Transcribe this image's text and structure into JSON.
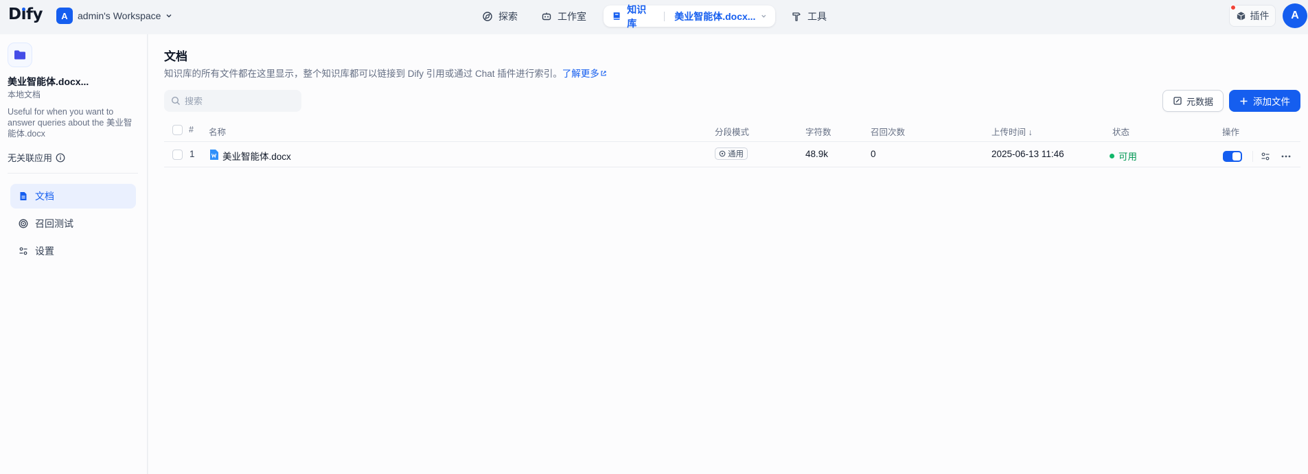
{
  "header": {
    "logo_text": "Dify",
    "workspace_avatar": "A",
    "workspace_name": "admin's Workspace",
    "nav": [
      {
        "label": "探索",
        "icon": "compass-icon"
      },
      {
        "label": "工作室",
        "icon": "robot-icon"
      },
      {
        "label": "知识库",
        "icon": "book-icon",
        "active": true,
        "dataset": "美业智能体.docx..."
      },
      {
        "label": "工具",
        "icon": "hammer-icon"
      }
    ],
    "plugins_label": "插件",
    "user_avatar": "A"
  },
  "sidebar": {
    "dataset_title": "美业智能体.docx...",
    "dataset_subtitle": "本地文档",
    "dataset_description": "Useful for when you want to answer queries about the 美业智能体.docx",
    "linked_apps": "无关联应用",
    "menu": [
      {
        "label": "文档",
        "icon": "document-icon",
        "active": true
      },
      {
        "label": "召回测试",
        "icon": "target-icon"
      },
      {
        "label": "设置",
        "icon": "settings-icon"
      }
    ]
  },
  "main": {
    "title": "文档",
    "description": "知识库的所有文件都在这里显示，整个知识库都可以链接到 Dify 引用或通过 Chat 插件进行索引。",
    "learn_more": "了解更多",
    "search_placeholder": "搜索",
    "metadata_button": "元数据",
    "add_file_button": "添加文件",
    "table": {
      "headers": [
        "#",
        "名称",
        "分段模式",
        "字符数",
        "召回次数",
        "上传时间 ↓",
        "状态",
        "操作"
      ],
      "rows": [
        {
          "index": "1",
          "name": "美业智能体.docx",
          "chunk_mode": "通用",
          "chars": "48.9k",
          "recalls": "0",
          "uploaded": "2025-06-13 11:46",
          "status": "可用",
          "enabled": true
        }
      ]
    }
  },
  "colors": {
    "accent": "#155eef",
    "status_available": "#12b76a",
    "notification": "#f04438"
  }
}
